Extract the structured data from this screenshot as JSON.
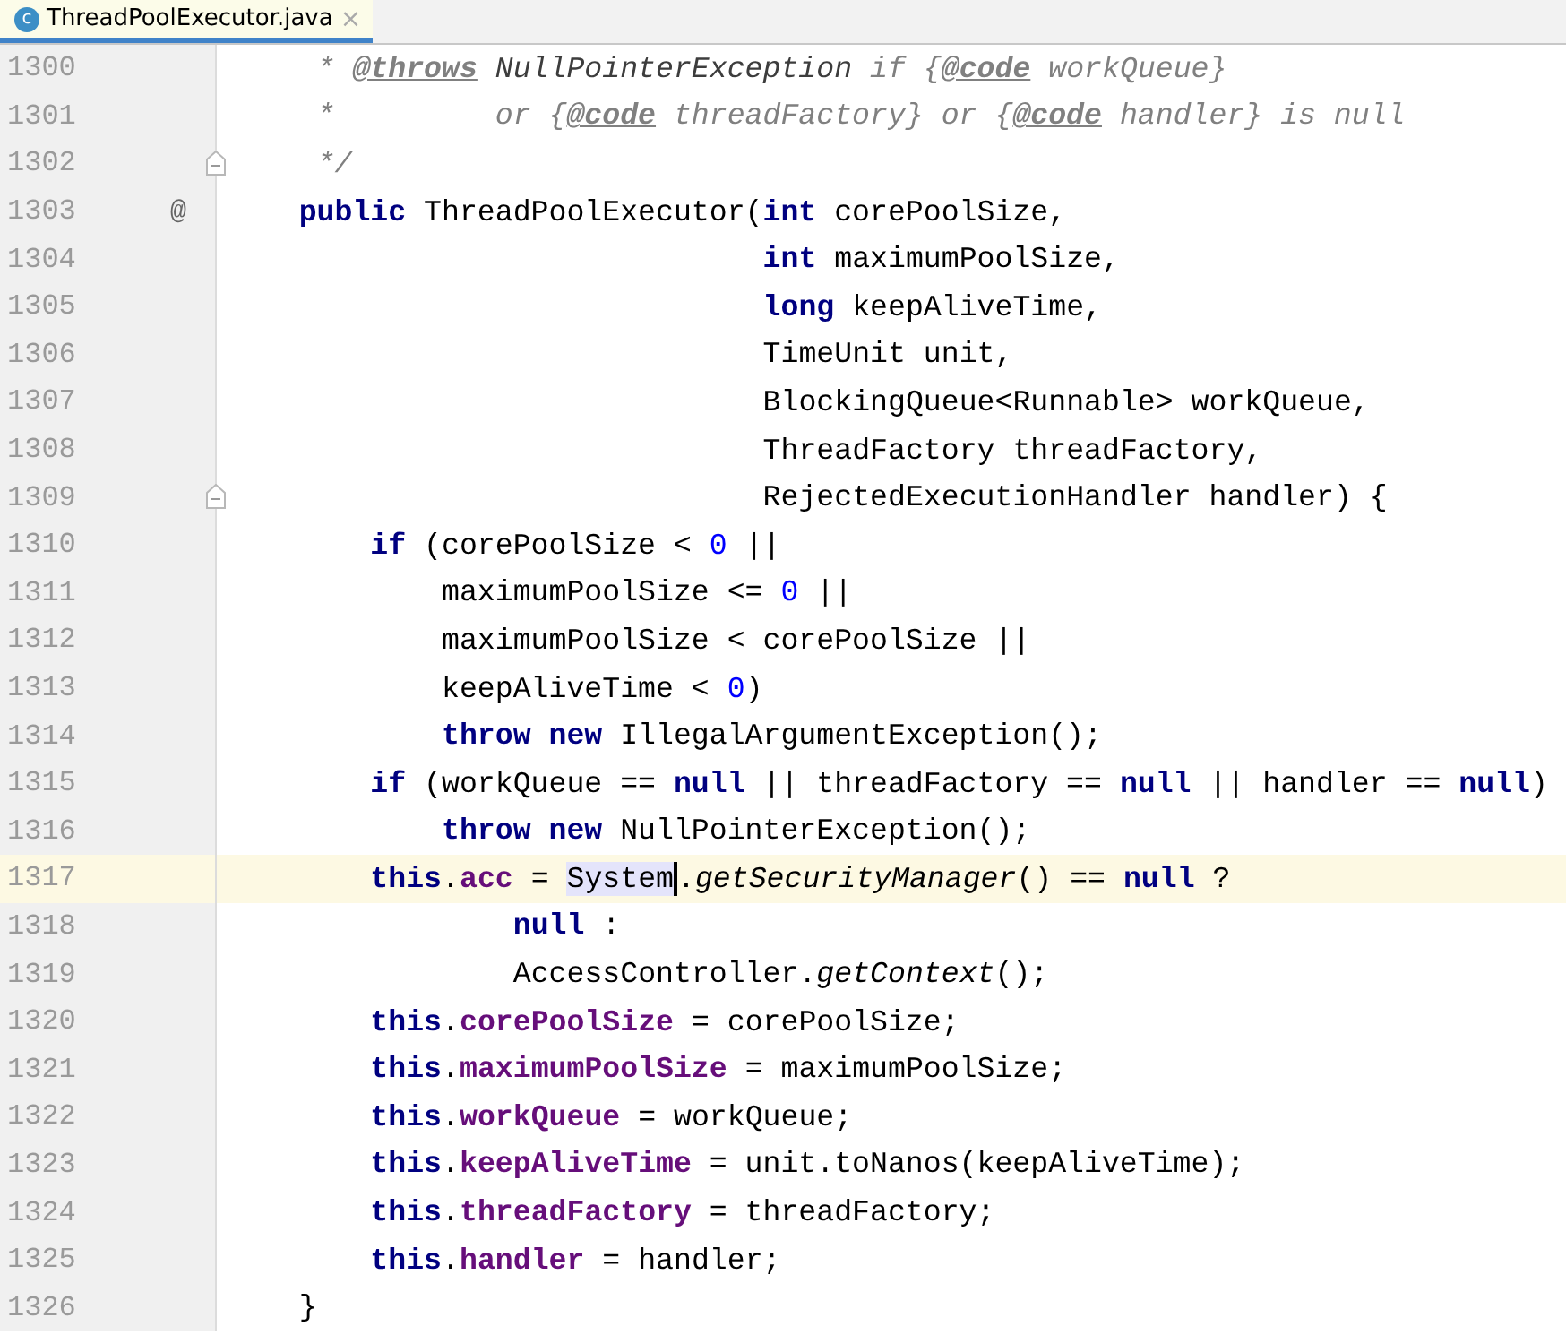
{
  "tab": {
    "icon_letter": "c",
    "title": "ThreadPoolExecutor.java",
    "close": "×",
    "selected": true
  },
  "lines": [
    {
      "number": "1300",
      "tokens": [
        {
          "kind": "doc",
          "t": "* "
        },
        {
          "kind": "doctag",
          "t": "@throws"
        },
        {
          "kind": "docref",
          "t": " NullPointerException"
        },
        {
          "kind": "doc",
          "t": " if {"
        },
        {
          "kind": "doctag",
          "t": "@code"
        },
        {
          "kind": "doc",
          "t": " workQueue}"
        }
      ]
    },
    {
      "number": "1301",
      "tokens": [
        {
          "kind": "doc",
          "t": "*         or {"
        },
        {
          "kind": "doctag",
          "t": "@code"
        },
        {
          "kind": "doc",
          "t": " threadFactory} or {"
        },
        {
          "kind": "doctag",
          "t": "@code"
        },
        {
          "kind": "doc",
          "t": " handler} is null"
        }
      ]
    },
    {
      "number": "1302",
      "fold": true,
      "tokens": [
        {
          "kind": "doc",
          "t": "*/"
        }
      ]
    },
    {
      "number": "1303",
      "marker": "@",
      "tokens": [
        {
          "kind": "kw",
          "t": "public"
        },
        {
          "kind": "plain",
          "t": " ThreadPoolExecutor("
        },
        {
          "kind": "kw",
          "t": "int"
        },
        {
          "kind": "plain",
          "t": " corePoolSize,"
        }
      ]
    },
    {
      "number": "1304",
      "tokens": [
        {
          "kind": "kw",
          "t": "int"
        },
        {
          "kind": "plain",
          "t": " maximumPoolSize,"
        }
      ]
    },
    {
      "number": "1305",
      "tokens": [
        {
          "kind": "kw",
          "t": "long"
        },
        {
          "kind": "plain",
          "t": " keepAliveTime,"
        }
      ]
    },
    {
      "number": "1306",
      "tokens": [
        {
          "kind": "plain",
          "t": "TimeUnit unit,"
        }
      ]
    },
    {
      "number": "1307",
      "tokens": [
        {
          "kind": "plain",
          "t": "BlockingQueue<Runnable> workQueue,"
        }
      ]
    },
    {
      "number": "1308",
      "tokens": [
        {
          "kind": "plain",
          "t": "ThreadFactory threadFactory,"
        }
      ]
    },
    {
      "number": "1309",
      "fold": true,
      "tokens": [
        {
          "kind": "plain",
          "t": "RejectedExecutionHandler handler) {"
        }
      ]
    },
    {
      "number": "1310",
      "tokens": [
        {
          "kind": "kw",
          "t": "if"
        },
        {
          "kind": "plain",
          "t": " (corePoolSize < "
        },
        {
          "kind": "num",
          "t": "0"
        },
        {
          "kind": "plain",
          "t": " ||"
        }
      ]
    },
    {
      "number": "1311",
      "tokens": [
        {
          "kind": "plain",
          "t": "maximumPoolSize <= "
        },
        {
          "kind": "num",
          "t": "0"
        },
        {
          "kind": "plain",
          "t": " ||"
        }
      ]
    },
    {
      "number": "1312",
      "tokens": [
        {
          "kind": "plain",
          "t": "maximumPoolSize < corePoolSize ||"
        }
      ]
    },
    {
      "number": "1313",
      "tokens": [
        {
          "kind": "plain",
          "t": "keepAliveTime < "
        },
        {
          "kind": "num",
          "t": "0"
        },
        {
          "kind": "plain",
          "t": ")"
        }
      ]
    },
    {
      "number": "1314",
      "tokens": [
        {
          "kind": "kw",
          "t": "throw new"
        },
        {
          "kind": "plain",
          "t": " IllegalArgumentException();"
        }
      ]
    },
    {
      "number": "1315",
      "tokens": [
        {
          "kind": "kw",
          "t": "if"
        },
        {
          "kind": "plain",
          "t": " (workQueue == "
        },
        {
          "kind": "kw",
          "t": "null"
        },
        {
          "kind": "plain",
          "t": " || threadFactory == "
        },
        {
          "kind": "kw",
          "t": "null"
        },
        {
          "kind": "plain",
          "t": " || handler == "
        },
        {
          "kind": "kw",
          "t": "null"
        },
        {
          "kind": "plain",
          "t": ")"
        }
      ]
    },
    {
      "number": "1316",
      "tokens": [
        {
          "kind": "kw",
          "t": "throw new"
        },
        {
          "kind": "plain",
          "t": " NullPointerException();"
        }
      ]
    },
    {
      "number": "1317",
      "current": true,
      "tokens": [
        {
          "kind": "kw",
          "t": "this"
        },
        {
          "kind": "plain",
          "t": "."
        },
        {
          "kind": "field",
          "t": "acc"
        },
        {
          "kind": "plain",
          "t": " = "
        },
        {
          "kind": "highlight",
          "t": "System"
        },
        {
          "kind": "plain",
          "t": "."
        },
        {
          "kind": "static",
          "t": "getSecurityManager"
        },
        {
          "kind": "plain",
          "t": "() == "
        },
        {
          "kind": "kw",
          "t": "null"
        },
        {
          "kind": "plain",
          "t": " ?"
        }
      ]
    },
    {
      "number": "1318",
      "tokens": [
        {
          "kind": "kw",
          "t": "null"
        },
        {
          "kind": "plain",
          "t": " :"
        }
      ]
    },
    {
      "number": "1319",
      "tokens": [
        {
          "kind": "plain",
          "t": "AccessController."
        },
        {
          "kind": "static",
          "t": "getContext"
        },
        {
          "kind": "plain",
          "t": "();"
        }
      ]
    },
    {
      "number": "1320",
      "tokens": [
        {
          "kind": "kw",
          "t": "this"
        },
        {
          "kind": "plain",
          "t": "."
        },
        {
          "kind": "field",
          "t": "corePoolSize"
        },
        {
          "kind": "plain",
          "t": " = corePoolSize;"
        }
      ]
    },
    {
      "number": "1321",
      "tokens": [
        {
          "kind": "kw",
          "t": "this"
        },
        {
          "kind": "plain",
          "t": "."
        },
        {
          "kind": "field",
          "t": "maximumPoolSize"
        },
        {
          "kind": "plain",
          "t": " = maximumPoolSize;"
        }
      ]
    },
    {
      "number": "1322",
      "tokens": [
        {
          "kind": "kw",
          "t": "this"
        },
        {
          "kind": "plain",
          "t": "."
        },
        {
          "kind": "field",
          "t": "workQueue"
        },
        {
          "kind": "plain",
          "t": " = workQueue;"
        }
      ]
    },
    {
      "number": "1323",
      "tokens": [
        {
          "kind": "kw",
          "t": "this"
        },
        {
          "kind": "plain",
          "t": "."
        },
        {
          "kind": "field",
          "t": "keepAliveTime"
        },
        {
          "kind": "plain",
          "t": " = unit.toNanos(keepAliveTime);"
        }
      ]
    },
    {
      "number": "1324",
      "tokens": [
        {
          "kind": "kw",
          "t": "this"
        },
        {
          "kind": "plain",
          "t": "."
        },
        {
          "kind": "field",
          "t": "threadFactory"
        },
        {
          "kind": "plain",
          "t": " = threadFactory;"
        }
      ]
    },
    {
      "number": "1325",
      "tokens": [
        {
          "kind": "kw",
          "t": "this"
        },
        {
          "kind": "plain",
          "t": "."
        },
        {
          "kind": "field",
          "t": "handler"
        },
        {
          "kind": "plain",
          "t": " = handler;"
        }
      ]
    },
    {
      "number": "1326",
      "tokens": [
        {
          "kind": "plain",
          "t": "}"
        }
      ]
    }
  ]
}
